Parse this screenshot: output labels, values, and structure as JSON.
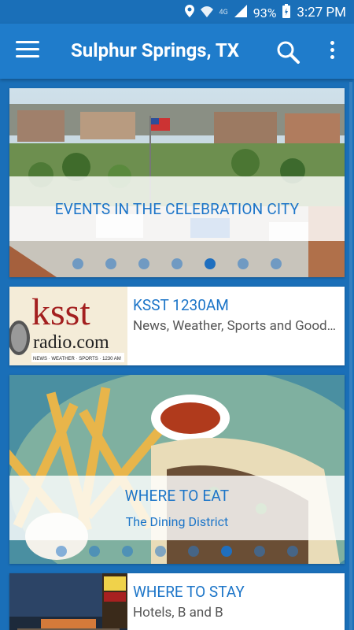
{
  "status": {
    "battery": "93%",
    "time": "3:27 PM",
    "network": "4G"
  },
  "appbar": {
    "title": "Sulphur Springs, TX"
  },
  "cards": {
    "events": {
      "title": "EVENTS IN THE CELEBRATION CITY",
      "dots": 7,
      "active_dot": 4
    },
    "radio": {
      "title": "KSST 1230AM",
      "subtitle": "News, Weather, Sports and Good Times",
      "logo_top": "ksst",
      "logo_mid": "radio.com",
      "logo_small": "NEWS · WEATHER · SPORTS · 1230 AM"
    },
    "eat": {
      "title": "WHERE TO EAT",
      "subtitle": "The Dining District",
      "dots": 8,
      "active_dot": 5
    },
    "stay": {
      "title": "WHERE TO STAY",
      "subtitle": "Hotels, B and B"
    }
  },
  "colors": {
    "primary": "#1f7ccb",
    "accent_text": "#1c75c8"
  }
}
